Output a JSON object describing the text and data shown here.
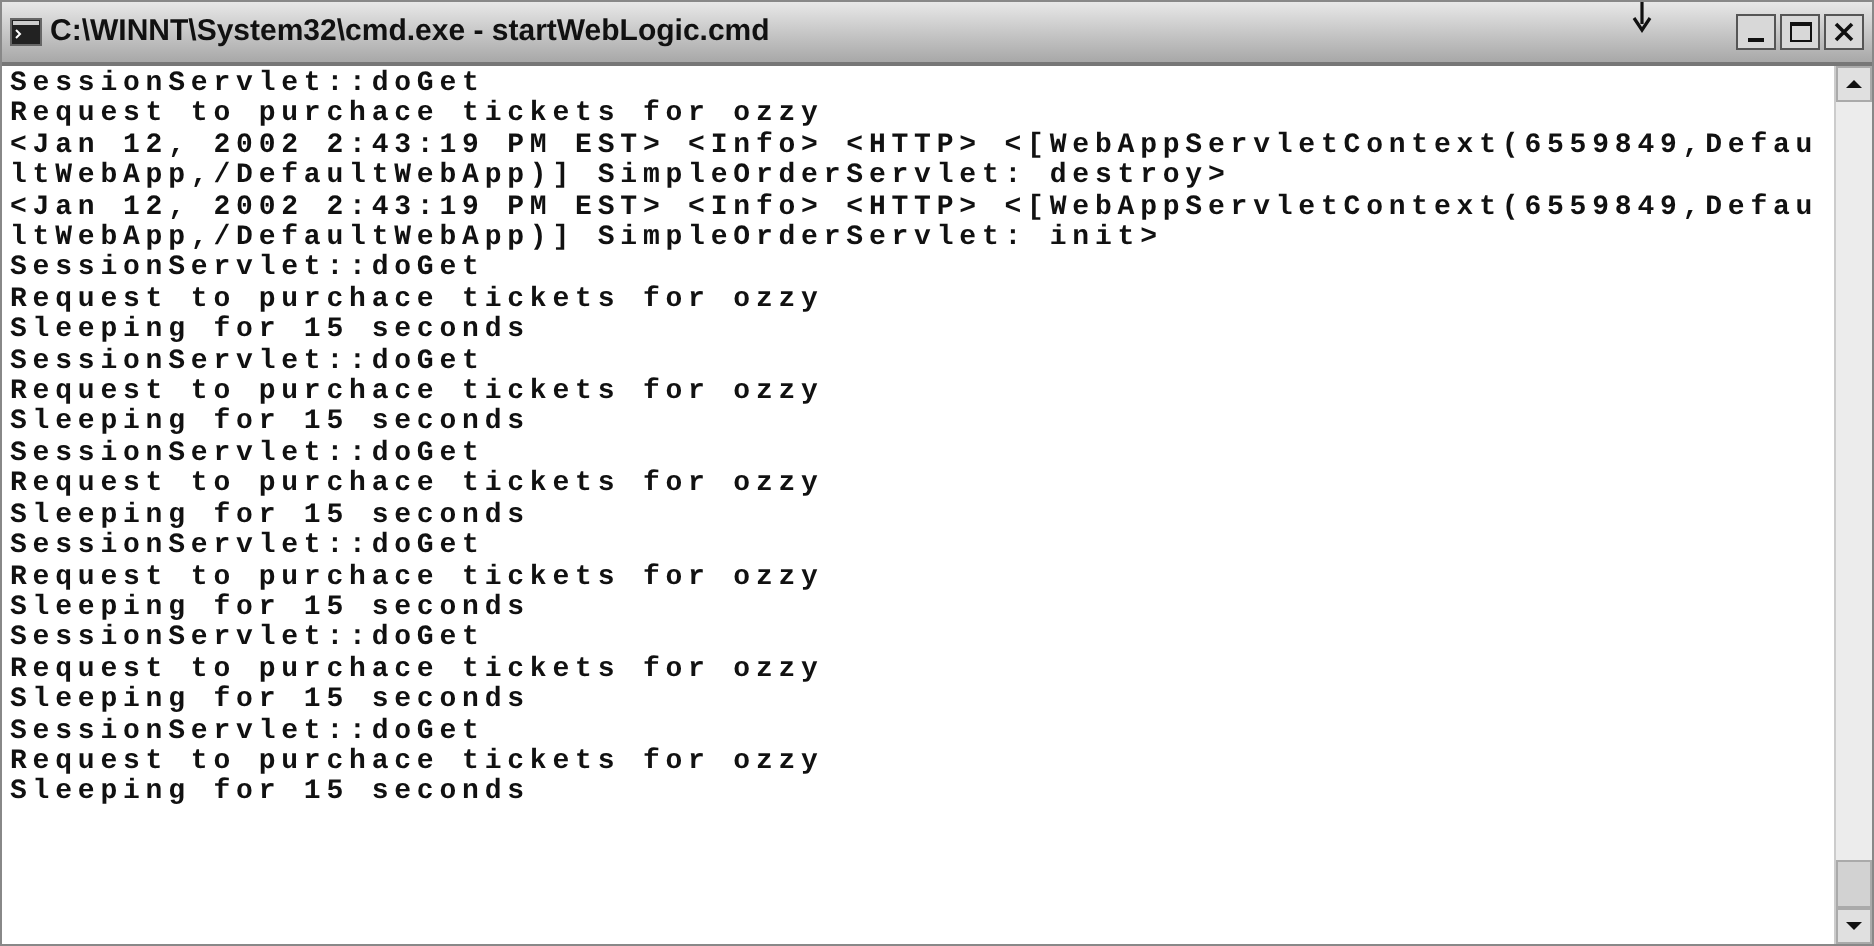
{
  "window": {
    "title": "C:\\WINNT\\System32\\cmd.exe - startWebLogic.cmd"
  },
  "console": {
    "lines": [
      "SessionServlet::doGet",
      "Request to purchace tickets for ozzy",
      "<Jan 12, 2002 2:43:19 PM EST> <Info> <HTTP> <[WebAppServletContext(6559849,Defau",
      "ltWebApp,/DefaultWebApp)] SimpleOrderServlet: destroy>",
      "<Jan 12, 2002 2:43:19 PM EST> <Info> <HTTP> <[WebAppServletContext(6559849,Defau",
      "ltWebApp,/DefaultWebApp)] SimpleOrderServlet: init>",
      "SessionServlet::doGet",
      "Request to purchace tickets for ozzy",
      "Sleeping for 15 seconds",
      "SessionServlet::doGet",
      "Request to purchace tickets for ozzy",
      "Sleeping for 15 seconds",
      "SessionServlet::doGet",
      "Request to purchace tickets for ozzy",
      "Sleeping for 15 seconds",
      "SessionServlet::doGet",
      "Request to purchace tickets for ozzy",
      "Sleeping for 15 seconds",
      "SessionServlet::doGet",
      "Request to purchace tickets for ozzy",
      "Sleeping for 15 seconds",
      "SessionServlet::doGet",
      "Request to purchace tickets for ozzy",
      "Sleeping for 15 seconds"
    ]
  }
}
